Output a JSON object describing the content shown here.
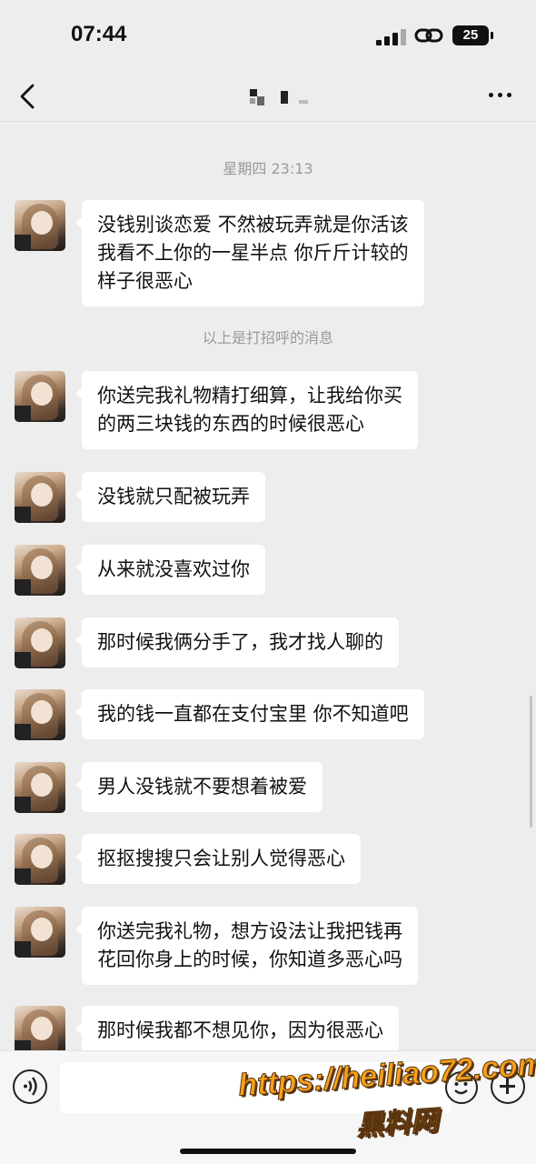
{
  "status_bar": {
    "time": "07:44",
    "battery": "25"
  },
  "header": {
    "contact_name": ""
  },
  "chat": {
    "timestamp": "星期四 23:13",
    "greeting_notice": "以上是打招呼的消息",
    "messages": [
      {
        "lines": [
          "没钱别谈恋爱 不然被玩弄就是你活该",
          "我看不上你的一星半点 你斤斤计较的",
          "样子很恶心"
        ]
      },
      {
        "lines": [
          "你送完我礼物精打细算，让我给你买",
          "的两三块钱的东西的时候很恶心"
        ]
      },
      {
        "lines": [
          "没钱就只配被玩弄"
        ]
      },
      {
        "lines": [
          "从来就没喜欢过你"
        ]
      },
      {
        "lines": [
          "那时候我俩分手了，我才找人聊的"
        ]
      },
      {
        "lines": [
          "我的钱一直都在支付宝里 你不知道吧"
        ]
      },
      {
        "lines": [
          "男人没钱就不要想着被爱"
        ]
      },
      {
        "lines": [
          "抠抠搜搜只会让别人觉得恶心"
        ]
      },
      {
        "lines": [
          "你送完我礼物，想方设法让我把钱再",
          "花回你身上的时候，你知道多恶心吗"
        ]
      },
      {
        "lines": [
          "那时候我都不想见你，因为很恶心"
        ]
      }
    ]
  },
  "watermark": {
    "url": "https://heiliao72.com",
    "site_name": "黑料网"
  },
  "icons": [
    "back-icon",
    "more-icon",
    "voice-icon",
    "emoji-icon",
    "plus-icon"
  ]
}
